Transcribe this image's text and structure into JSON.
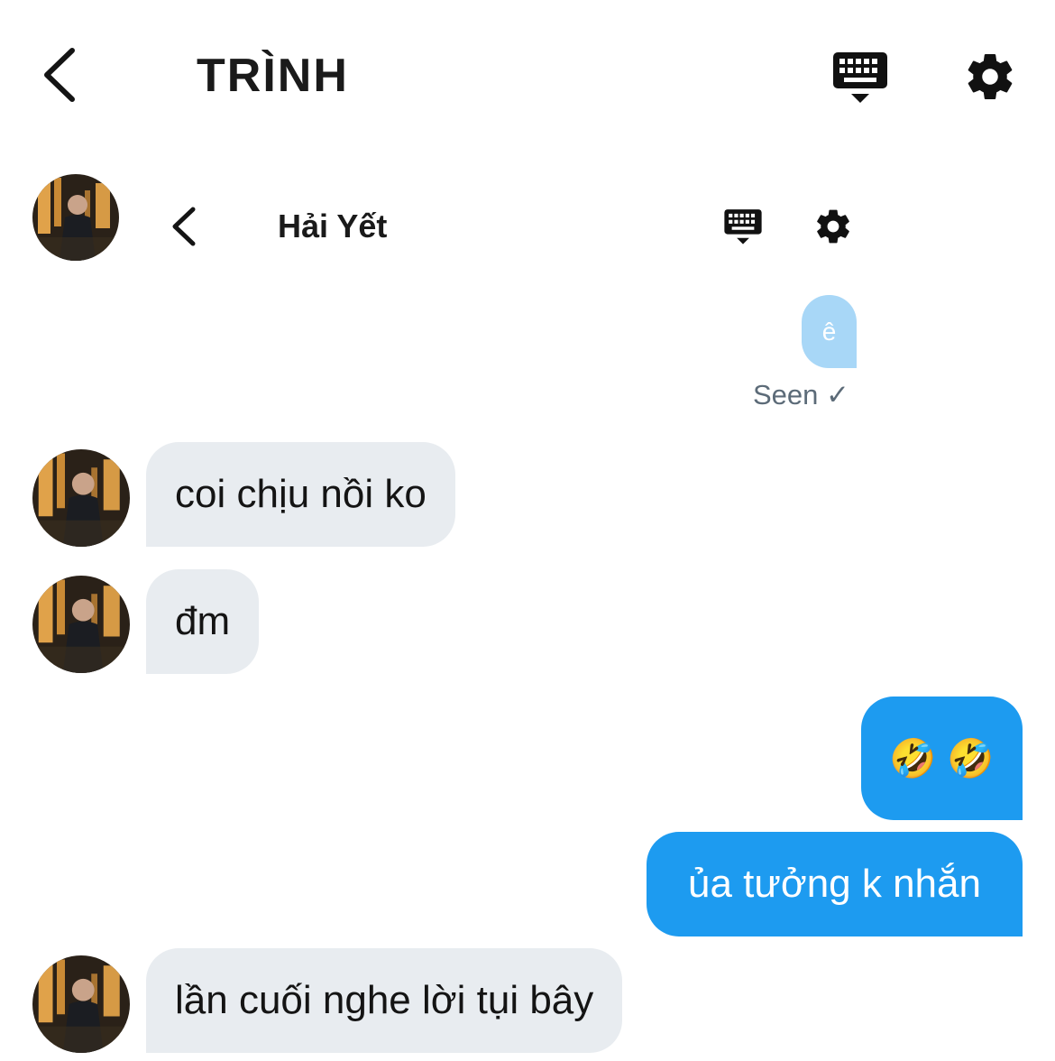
{
  "header": {
    "title": "TRÌNH",
    "back_icon": "chevron-left-icon",
    "keyboard_icon": "keyboard-icon",
    "settings_icon": "gear-icon"
  },
  "embedded_header": {
    "title": "Hải Yết",
    "back_icon": "chevron-left-icon",
    "keyboard_icon": "keyboard-icon",
    "settings_icon": "gear-icon"
  },
  "messages": [
    {
      "side": "out",
      "text": "ê"
    },
    {
      "status": "Seen ✓"
    },
    {
      "side": "in",
      "text": "coi chịu nồi ko"
    },
    {
      "side": "in",
      "text": "đm"
    },
    {
      "side": "out",
      "text": "🤣 🤣"
    },
    {
      "side": "out",
      "text": "ủa tưởng k nhắn"
    },
    {
      "side": "in",
      "text": "lần cuối nghe lời tụi bây"
    }
  ],
  "colors": {
    "outgoing_bubble": "#1d9bf0",
    "outgoing_bubble_faded": "#a8d7f7",
    "incoming_bubble": "#e8ecf0",
    "seen_text": "#5c6b78"
  }
}
